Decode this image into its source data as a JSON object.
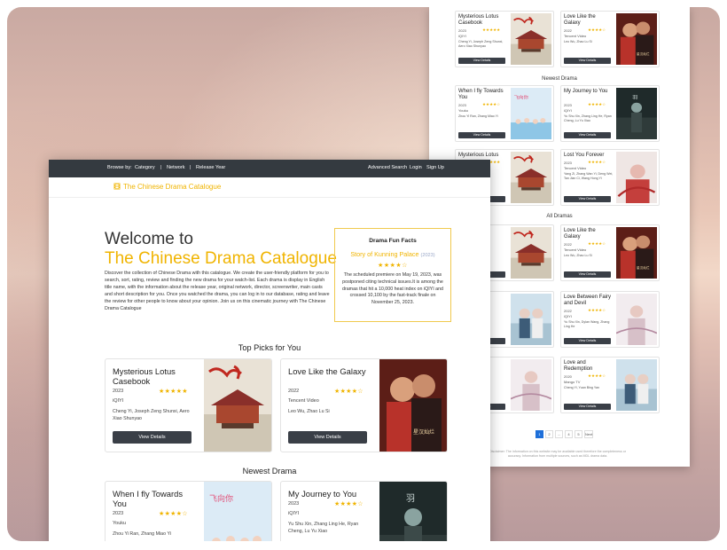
{
  "nav": {
    "browse_by": "Browse by:",
    "category": "Category",
    "sep": "|",
    "network": "Network",
    "release_year": "Release Year",
    "advanced_search": "Advanced Search",
    "login": "Login",
    "signup": "Sign Up",
    "brand": "The Chinese Drama Catalogue",
    "brand_icon": "film-icon"
  },
  "hero": {
    "welcome": "Welcome to",
    "title": "The Chinese Drama Catalogue",
    "intro": "Discover the collection of Chinese Drama with this catalogue. We create the user-friendly platform for you to search, sort, rating, review and finding the new drama for your watch-list. Each drama is display in English title name, with the information about the release year, original network, director, screenwriter, main casts and short description for you. Once you watched the drama, you can log in to our database, rating and leave the review for other people to know about your opinion. Join us on this cinematic journey with The Chinese Drama Catalogue"
  },
  "facts": {
    "heading": "Drama Fun Facts",
    "show": "Story of Kunning Palace",
    "year": "(2023)",
    "stars": "★★★★☆",
    "text": "The scheduled premiere on May 19, 2023, was postponed citing technical issues.It is among the dramas that hit a 10,000 heat index on iQIYI and crossed 10,100 by the fast-track finale on November 25, 2023."
  },
  "sections": {
    "top_picks": "Top Picks for You",
    "newest": "Newest Drama",
    "all": "All Dramas"
  },
  "button_label": "View Details",
  "top_picks": [
    {
      "title": "Mysterious Lotus Casebook",
      "year": "2023",
      "stars": "★★★★★",
      "network": "iQIYI",
      "cast": "Cheng Yi, Joseph Zeng Shunxi, Aero Xiao Shunyao"
    },
    {
      "title": "Love Like the Galaxy",
      "year": "2022",
      "stars": "★★★★☆",
      "network": "Tencent Video",
      "cast": "Leo Wu, Zhao Lu Si"
    }
  ],
  "newest": [
    {
      "title": "When I fly Towards You",
      "year": "2023",
      "stars": "★★★★☆",
      "network": "Youku",
      "cast": "Zhou Yi Ran, Zhang Miao Yi"
    },
    {
      "title": "My Journey to You",
      "year": "2023",
      "stars": "★★★★☆",
      "network": "iQIYI",
      "cast": "Yu Shu Xin, Zhang Ling He, Ryan Cheng, Lu Yu Xiao"
    }
  ],
  "back_rows": [
    {
      "left": {
        "title": "Mysterious Lotus Casebook",
        "year": "2023",
        "stars": "★★★★★",
        "network": "iQIYI",
        "cast": "Cheng Yi, Joseph Zeng Shunxi, Aero Xiao Shunyao"
      },
      "right": {
        "title": "Love Like the Galaxy",
        "year": "2022",
        "stars": "★★★★☆",
        "network": "Tencent Video",
        "cast": "Leo Wu, Zhao Lu Si"
      }
    },
    {
      "left": {
        "title": "When I fly Towards You",
        "year": "2023",
        "stars": "★★★★☆",
        "network": "Youku",
        "cast": "Zhou Yi Ran, Zhang Miao Yi"
      },
      "right": {
        "title": "My Journey to You",
        "year": "2023",
        "stars": "★★★★☆",
        "network": "iQIYI",
        "cast": "Yu Shu Xin, Zhang Ling He, Ryan Cheng, Lu Yu Xiao"
      }
    },
    {
      "left": {
        "title": "Mysterious Lotus",
        "year": "2023",
        "stars": "★★★★★",
        "network": "iQIYI",
        "cast": ""
      },
      "right": {
        "title": "Lost You Forever",
        "year": "2023",
        "stars": "★★★★☆",
        "network": "Tencent Video",
        "cast": "Yang Zi, Zhang Wan Yi, Deng Wei, Tan Jian Ci, Wang Hong Yi"
      }
    },
    {
      "left": {
        "title": "",
        "year": "",
        "stars": "",
        "network": "",
        "cast": ""
      },
      "right": {
        "title": "Love Like the Galaxy",
        "year": "2022",
        "stars": "★★★★☆",
        "network": "Tencent Video",
        "cast": "Leo Wu, Zhao Lu Si"
      }
    },
    {
      "left": {
        "title": "",
        "year": "",
        "stars": "",
        "network": "",
        "cast": ""
      },
      "right": {
        "title": "Love Between Fairy and Devil",
        "year": "2022",
        "stars": "★★★★☆",
        "network": "iQIYI",
        "cast": "Yu Shu Xin, Dylan Wang, Zhang Ling He"
      }
    },
    {
      "left": {
        "title": "",
        "year": "",
        "stars": "",
        "network": "",
        "cast": ""
      },
      "right": {
        "title": "Love and Redemption",
        "year": "2020",
        "stars": "★★★★☆",
        "network": "Mango TV",
        "cast": "Cheng Yi, Yuan Bing Yan"
      }
    }
  ],
  "pagination": [
    "1",
    "2",
    "...",
    "4",
    "5",
    "Next"
  ],
  "footer": "Disclaimer: The information on this website may be available used therefore the completeness or accuracy. Information from multiple sources, such as MDL drama data."
}
